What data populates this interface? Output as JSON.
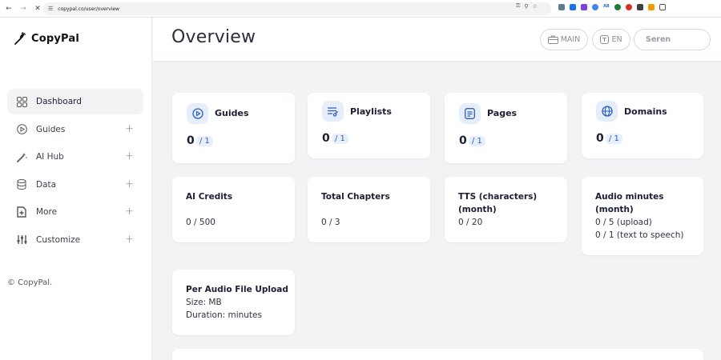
{
  "browser": {
    "url": "copypal.co/user/overview",
    "back_icon": "arrow-left-icon",
    "forward_icon": "arrow-right-icon",
    "close_icon": "close-icon"
  },
  "brand": {
    "name": "CopyPal",
    "accent": "#2c5fbf"
  },
  "sidebar": {
    "items": [
      {
        "label": "Dashboard",
        "icon": "grid-icon",
        "active": true
      },
      {
        "label": "Guides",
        "icon": "play-circle-icon",
        "expand": "+"
      },
      {
        "label": "AI Hub",
        "icon": "magic-wand-icon",
        "expand": "+"
      },
      {
        "label": "Data",
        "icon": "database-icon",
        "expand": "+"
      },
      {
        "label": "More",
        "icon": "document-plus-icon",
        "expand": "+"
      },
      {
        "label": "Customize",
        "icon": "sliders-icon",
        "expand": "+"
      }
    ],
    "copyright": "© CopyPal."
  },
  "header": {
    "title": "Overview",
    "main_label": "MAIN",
    "lang_label": "EN",
    "user_label": "Seren"
  },
  "stats": [
    {
      "title": "Guides",
      "count": "0",
      "cap": "/ 1",
      "icon": "play-circle-icon"
    },
    {
      "title": "Playlists",
      "count": "0",
      "cap": "/ 1",
      "icon": "playlist-icon"
    },
    {
      "title": "Pages",
      "count": "0",
      "cap": "/ 1",
      "icon": "page-icon"
    },
    {
      "title": "Domains",
      "count": "0",
      "cap": "/ 1",
      "icon": "globe-icon"
    }
  ],
  "usage": [
    {
      "title": "AI Credits",
      "lines": [
        "0 / 500"
      ]
    },
    {
      "title": "Total Chapters",
      "lines": [
        "0 / 3"
      ]
    },
    {
      "title_lines": [
        "TTS (characters)",
        "(month)"
      ],
      "lines": [
        "0 / 20"
      ]
    },
    {
      "title_lines": [
        "Audio minutes",
        "(month)"
      ],
      "lines": [
        "0 / 5 (upload)",
        "0 / 1 (text to speech)"
      ]
    }
  ],
  "upload": {
    "title": "Per Audio File Upload",
    "size": "Size: MB",
    "duration": "Duration: minutes"
  }
}
